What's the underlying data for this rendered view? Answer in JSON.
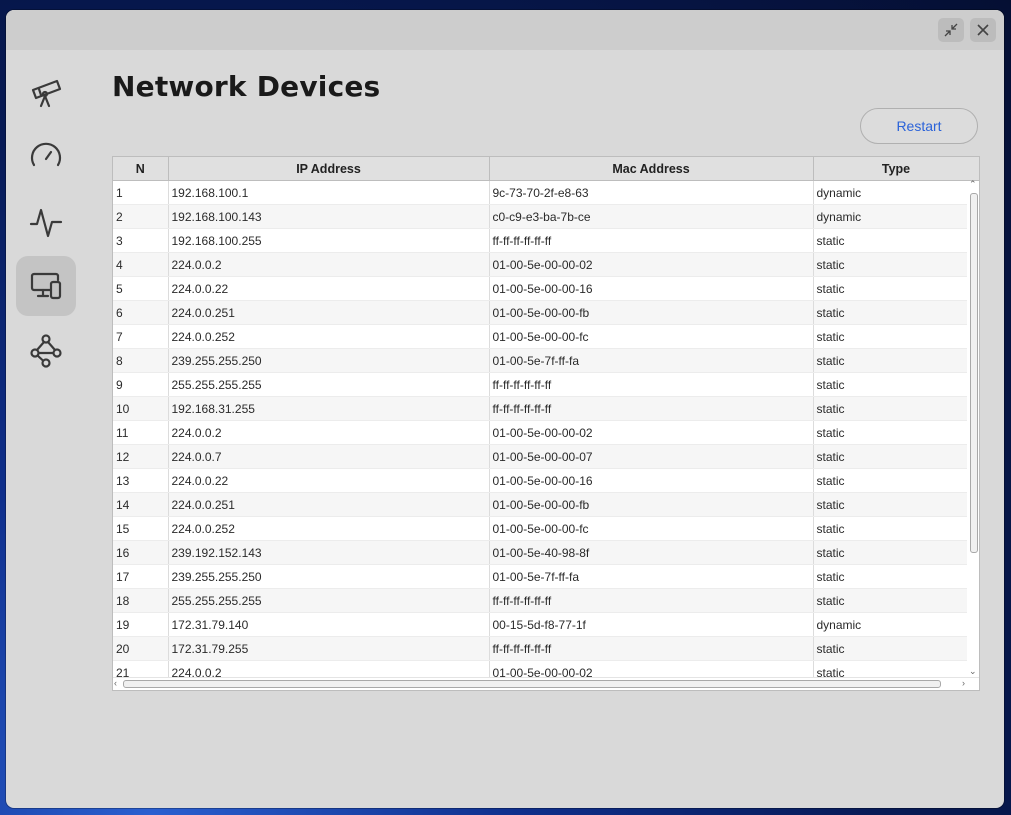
{
  "page": {
    "title": "Network Devices",
    "restart_label": "Restart"
  },
  "sidebar": {
    "items": [
      {
        "name": "telescope",
        "icon": "telescope-icon"
      },
      {
        "name": "speedometer",
        "icon": "speedometer-icon"
      },
      {
        "name": "activity",
        "icon": "activity-pulse-icon"
      },
      {
        "name": "devices",
        "icon": "devices-icon",
        "active": true
      },
      {
        "name": "network",
        "icon": "share-network-icon"
      }
    ]
  },
  "table": {
    "columns": [
      "N",
      "IP Address",
      "Mac Address",
      "Type"
    ],
    "rows": [
      [
        "1",
        "192.168.100.1",
        "9c-73-70-2f-e8-63",
        "dynamic"
      ],
      [
        "2",
        "192.168.100.143",
        "c0-c9-e3-ba-7b-ce",
        "dynamic"
      ],
      [
        "3",
        "192.168.100.255",
        "ff-ff-ff-ff-ff-ff",
        "static"
      ],
      [
        "4",
        "224.0.0.2",
        "01-00-5e-00-00-02",
        "static"
      ],
      [
        "5",
        "224.0.0.22",
        "01-00-5e-00-00-16",
        "static"
      ],
      [
        "6",
        "224.0.0.251",
        "01-00-5e-00-00-fb",
        "static"
      ],
      [
        "7",
        "224.0.0.252",
        "01-00-5e-00-00-fc",
        "static"
      ],
      [
        "8",
        "239.255.255.250",
        "01-00-5e-7f-ff-fa",
        "static"
      ],
      [
        "9",
        "255.255.255.255",
        "ff-ff-ff-ff-ff-ff",
        "static"
      ],
      [
        "10",
        "192.168.31.255",
        "ff-ff-ff-ff-ff-ff",
        "static"
      ],
      [
        "11",
        "224.0.0.2",
        "01-00-5e-00-00-02",
        "static"
      ],
      [
        "12",
        "224.0.0.7",
        "01-00-5e-00-00-07",
        "static"
      ],
      [
        "13",
        "224.0.0.22",
        "01-00-5e-00-00-16",
        "static"
      ],
      [
        "14",
        "224.0.0.251",
        "01-00-5e-00-00-fb",
        "static"
      ],
      [
        "15",
        "224.0.0.252",
        "01-00-5e-00-00-fc",
        "static"
      ],
      [
        "16",
        "239.192.152.143",
        "01-00-5e-40-98-8f",
        "static"
      ],
      [
        "17",
        "239.255.255.250",
        "01-00-5e-7f-ff-fa",
        "static"
      ],
      [
        "18",
        "255.255.255.255",
        "ff-ff-ff-ff-ff-ff",
        "static"
      ],
      [
        "19",
        "172.31.79.140",
        "00-15-5d-f8-77-1f",
        "dynamic"
      ],
      [
        "20",
        "172.31.79.255",
        "ff-ff-ff-ff-ff-ff",
        "static"
      ],
      [
        "21",
        "224.0.0.2",
        "01-00-5e-00-00-02",
        "static"
      ]
    ]
  },
  "colors": {
    "accent": "#2b63d9",
    "window_bg": "#d9d9d9",
    "titlebar_bg": "#cdcdcd"
  }
}
